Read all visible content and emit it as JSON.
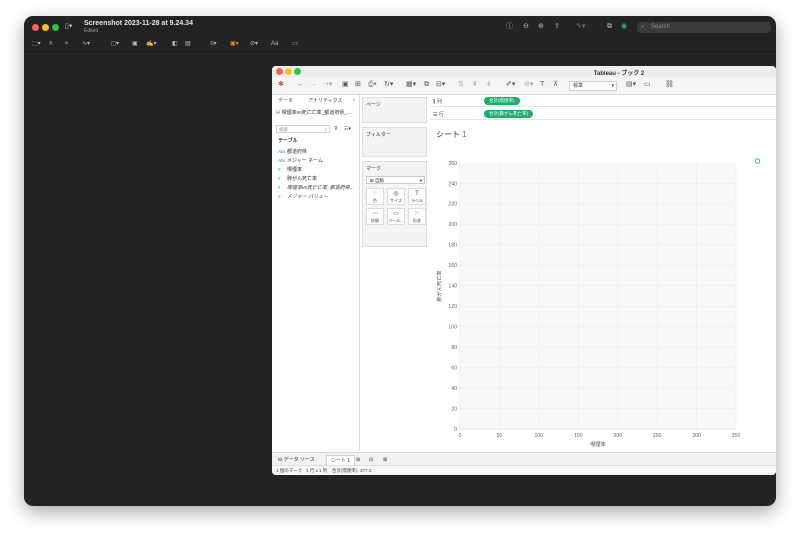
{
  "preview": {
    "title": "Screenshot 2023-11-28 at 9.24.34",
    "subtitle": "Edited",
    "search_placeholder": "Search",
    "font_button": "Aa"
  },
  "tableau": {
    "window_title": "Tableau - ブック 2",
    "fit_option": "標準",
    "data_tab": "データ",
    "analytics_tab": "アナリティクス",
    "data_source": "喫煙率vs死亡亡率_都道府県_...",
    "search_placeholder": "検索",
    "table_heading": "テーブル",
    "fields": [
      {
        "icon": "Abc",
        "name": "都道府県",
        "kind": "dimension"
      },
      {
        "icon": "Abc",
        "name": "メジャー ネーム",
        "kind": "dimension"
      },
      {
        "icon": "#",
        "name": "喫煙率",
        "kind": "measure"
      },
      {
        "icon": "#",
        "name": "肺がん死亡率",
        "kind": "measure"
      },
      {
        "icon": "#",
        "name": "喫煙率vs死亡亡率_都道府県...",
        "kind": "measure"
      },
      {
        "icon": "#",
        "name": "メジャー バリュー",
        "kind": "measure"
      }
    ],
    "pages_label": "ページ",
    "filters_label": "フィルター",
    "marks_label": "マーク",
    "marks_type": "自動",
    "mark_buttons": [
      {
        "glyph": "⁘",
        "label": "色"
      },
      {
        "glyph": "◎",
        "label": "サイズ"
      },
      {
        "glyph": "T",
        "label": "ラベル"
      },
      {
        "glyph": "⋯",
        "label": "詳細"
      },
      {
        "glyph": "▭",
        "label": "ツール..."
      },
      {
        "glyph": "⁙",
        "label": "形状"
      }
    ],
    "columns_label": "列",
    "rows_label": "行",
    "columns_pill": "合計(喫煙率)",
    "rows_pill": "合計(肺がん死亡率)",
    "sheet_title": "シート",
    "sheet_number": "1",
    "datasource_tab": "データ ソース",
    "sheet_tab": "シート 1",
    "status_marks": "1 個のマーク",
    "status_rows": "1 行 x 1 列",
    "status_sum": "合計(喫煙率): 377.3"
  },
  "chart_data": {
    "type": "scatter",
    "xlabel": "喫煙率",
    "ylabel": "肺がん死亡率",
    "xlim": [
      0,
      350
    ],
    "ylim": [
      0,
      260
    ],
    "x_ticks": [
      0,
      50,
      100,
      150,
      200,
      250,
      300,
      350
    ],
    "y_ticks": [
      0,
      20,
      40,
      60,
      80,
      100,
      120,
      140,
      160,
      180,
      200,
      220,
      240,
      260
    ],
    "points": [
      {
        "x": 377.3,
        "y": 262
      }
    ],
    "point_color": "#2aa876",
    "grid": true
  }
}
